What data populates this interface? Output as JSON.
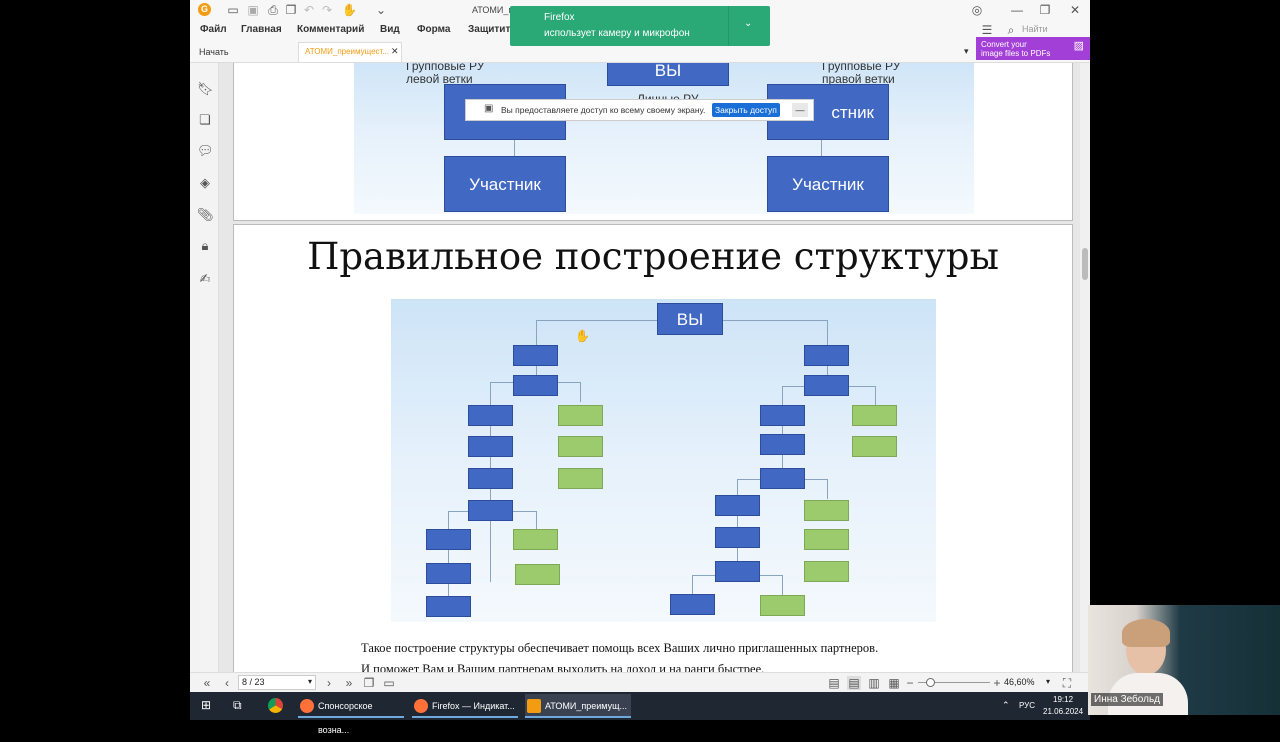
{
  "window": {
    "title": "АТОМИ_п...          ...ижения.pdf - Foxit PDF Reader",
    "search_placeholder": "Найти",
    "convert_promo_line1": "Convert your",
    "convert_promo_line2": "image files to PDFs"
  },
  "menu": [
    "Файл",
    "Главная",
    "Комментарий",
    "Вид",
    "Форма",
    "Защитить"
  ],
  "tabs": {
    "start": "Начать",
    "doc": "АТОМИ_преимущест..."
  },
  "firefox_notice": {
    "title": "Firefox",
    "text": "использует камеру и микрофон"
  },
  "share_bar": {
    "text": "Вы предоставляете доступ ко всему своему экрану.",
    "button": "Закрыть доступ"
  },
  "page1": {
    "left_group_label": "Групповые РУ левой ветки",
    "right_group_label": "Групповые РУ правой ветки",
    "top_box": "ВЫ",
    "personal_label": "Личные РУ",
    "participant": "Участник",
    "participant_partial": "стник"
  },
  "page2": {
    "heading": "Правильное построение структуры",
    "top_box": "ВЫ",
    "body_line1": "Такое построение структуры обеспечивает помощь всех Ваших лично приглашенных партнеров.",
    "body_line2": "И поможет Вам и Вашим партнерам выходить на доход и на ранги быстрее."
  },
  "statusbar": {
    "page": "8 / 23",
    "zoom": "46,60%"
  },
  "taskbar": {
    "apps": [
      "Спонсорское вознa...",
      "Firefox — Индикат...",
      "АТОМИ_преимущ..."
    ],
    "lang": "РУС",
    "time": "19:12",
    "date": "21.06.2024"
  },
  "webcam": {
    "name": "Инна Зебольд"
  },
  "colors": {
    "accent": "#f39c12",
    "firefox_notice_bg": "#2aa876",
    "share_button_bg": "#1a6fd6",
    "box_blue": "#4169c4",
    "box_green": "#9ccb6e",
    "promo_bg": "#a23fd6"
  }
}
